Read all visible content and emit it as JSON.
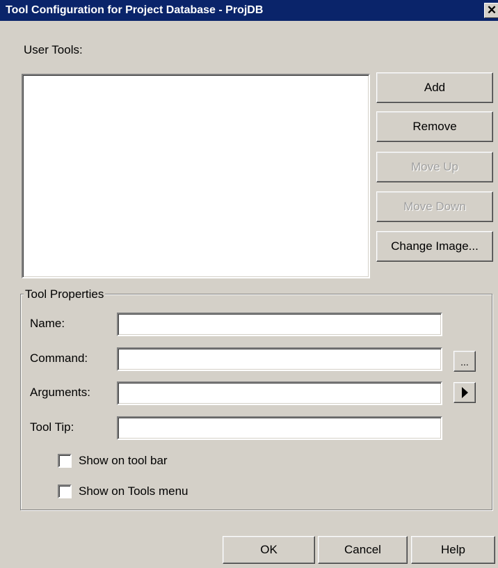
{
  "window": {
    "title": "Tool Configuration for Project Database - ProjDB",
    "close_glyph": "✕"
  },
  "user_tools": {
    "label": "User Tools:",
    "items": []
  },
  "side_buttons": {
    "add": "Add",
    "remove": "Remove",
    "move_up": "Move Up",
    "move_down": "Move Down",
    "change_image": "Change Image..."
  },
  "tool_properties": {
    "legend": "Tool Properties",
    "name_label": "Name:",
    "name_value": "",
    "command_label": "Command:",
    "command_value": "",
    "browse_button": "...",
    "arguments_label": "Arguments:",
    "arguments_value": "",
    "arguments_menu_icon": "play-triangle-icon",
    "tooltip_label": "Tool Tip:",
    "tooltip_value": "",
    "show_toolbar_label": "Show on tool bar",
    "show_toolbar_checked": false,
    "show_tools_menu_label": "Show on Tools menu",
    "show_tools_menu_checked": false
  },
  "footer": {
    "ok": "OK",
    "cancel": "Cancel",
    "help": "Help"
  }
}
